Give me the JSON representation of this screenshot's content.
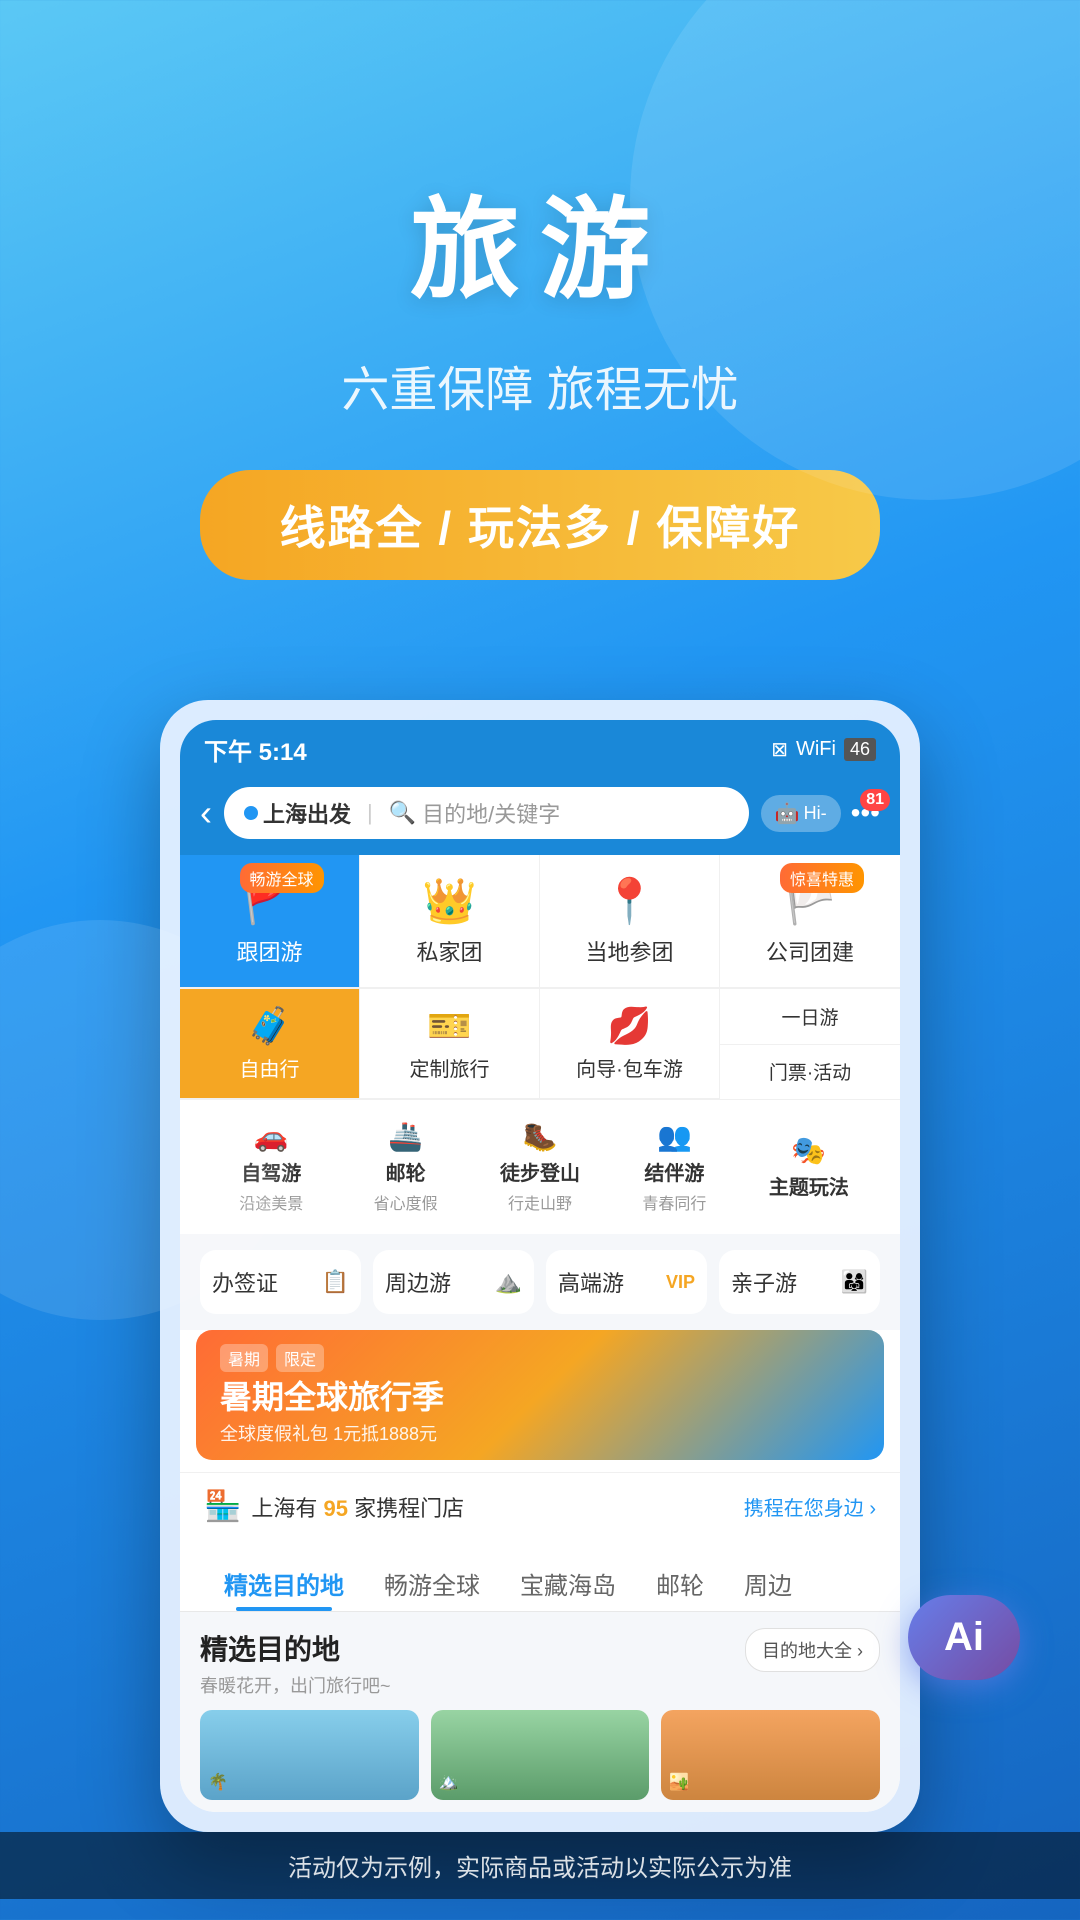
{
  "app": {
    "title": "旅游",
    "subtitle": "六重保障 旅程无忧",
    "badge": "线路全 / 玩法多 / 保障好"
  },
  "status_bar": {
    "time": "下午 5:14",
    "icons": "📶 46"
  },
  "nav": {
    "location": "上海出发",
    "search_placeholder": "目的地/关键字",
    "hi_label": "Hi-",
    "badge_count": "81"
  },
  "menu_top": [
    {
      "id": "group-tour",
      "label": "跟团游",
      "icon": "🚩",
      "badge": "畅游全球",
      "style": "blue"
    },
    {
      "id": "private-tour",
      "label": "私家团",
      "icon": "👑",
      "badge": "",
      "style": "normal"
    },
    {
      "id": "local-tour",
      "label": "当地参团",
      "icon": "📍",
      "badge": "",
      "style": "normal"
    },
    {
      "id": "company-tour",
      "label": "公司团建",
      "icon": "🏳️",
      "badge": "惊喜特惠",
      "style": "normal"
    }
  ],
  "menu_second": [
    {
      "id": "free-travel",
      "label": "自由行",
      "icon": "🧳",
      "style": "orange"
    },
    {
      "id": "custom-travel",
      "label": "定制旅行",
      "icon": "🎫",
      "style": "normal"
    },
    {
      "id": "guide-car",
      "label": "向导·包车游",
      "icon": "💋",
      "style": "normal"
    },
    {
      "id": "oneday-tour",
      "label": "一日游",
      "style": "right-top",
      "icon": ""
    },
    {
      "id": "ticket-activity",
      "label": "门票·活动",
      "style": "right-bottom",
      "icon": ""
    }
  ],
  "services": [
    {
      "id": "self-drive",
      "label": "自驾游",
      "sub": "沿途美景",
      "icon": "🚗"
    },
    {
      "id": "cruise",
      "label": "邮轮",
      "sub": "省心度假",
      "icon": "🚢"
    },
    {
      "id": "hiking",
      "label": "徒步登山",
      "sub": "行走山野",
      "icon": "🥾"
    },
    {
      "id": "companion",
      "label": "结伴游",
      "sub": "青春同行",
      "icon": "👥"
    },
    {
      "id": "theme",
      "label": "主题玩法",
      "sub": "",
      "icon": "🎭"
    }
  ],
  "quick_links": [
    {
      "id": "visa",
      "label": "办签证",
      "icon": "📋"
    },
    {
      "id": "nearby",
      "label": "周边游",
      "icon": "⛰️"
    },
    {
      "id": "luxury",
      "label": "高端游",
      "icon": "VIP",
      "tag": "VIP"
    },
    {
      "id": "family",
      "label": "亲子游",
      "icon": "👨‍👩‍👧"
    }
  ],
  "banner": {
    "title": "暑期全球旅行季",
    "sub": "全球度假礼包 1元抵1888元"
  },
  "store": {
    "text_prefix": "上海有",
    "count": "95",
    "text_suffix": "家携程门店",
    "link": "携程在您身边 ›"
  },
  "tabs": [
    {
      "id": "selected-dest",
      "label": "精选目的地",
      "active": true
    },
    {
      "id": "global",
      "label": "畅游全球",
      "active": false
    },
    {
      "id": "island",
      "label": "宝藏海岛",
      "active": false
    },
    {
      "id": "cruise-tab",
      "label": "邮轮",
      "active": false
    },
    {
      "id": "nearby-tab",
      "label": "周边",
      "active": false
    }
  ],
  "selected_section": {
    "title": "精选目的地",
    "sub": "春暖花开，出门旅行吧~",
    "link": "目的地大全 ›"
  },
  "disclaimer": "活动仅为示例，实际商品或活动以实际公示为准",
  "ai_button": "Ai"
}
